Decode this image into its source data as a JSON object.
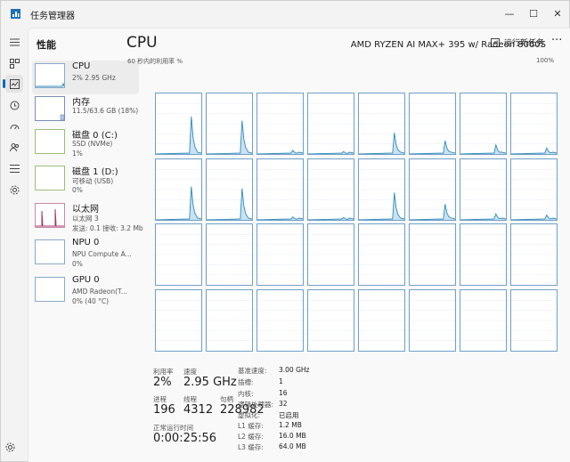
{
  "app": {
    "title": "任务管理器"
  },
  "window_buttons": {
    "minimize": "—",
    "maximize": "☐",
    "close": "✕"
  },
  "page": {
    "title": "性能",
    "run_task": "运行新任务",
    "more": "···"
  },
  "rail": [
    "hamburger-icon",
    "processes-icon",
    "performance-icon",
    "history-icon",
    "startup-icon",
    "users-icon",
    "details-icon",
    "services-icon"
  ],
  "sidebar": [
    {
      "name": "CPU",
      "l2": "2% 2.95 GHz",
      "l3": ""
    },
    {
      "name": "内存",
      "l2": "11.5/63.6 GB (18%)",
      "l3": ""
    },
    {
      "name": "磁盘 0 (C:)",
      "l2": "SSD (NVMe)",
      "l3": "1%"
    },
    {
      "name": "磁盘 1 (D:)",
      "l2": "可移动 (USB)",
      "l3": "0%"
    },
    {
      "name": "以太网",
      "l2": "以太网 3",
      "l3": "发送: 0.1  接收: 3.2 Mb"
    },
    {
      "name": "NPU 0",
      "l2": "NPU Compute A...",
      "l3": "0%"
    },
    {
      "name": "GPU 0",
      "l2": "AMD Radeon(T...",
      "l3": "0% (40 °C)"
    }
  ],
  "main": {
    "title": "CPU",
    "model": "AMD RYZEN AI MAX+ 395 w/ Radeon 8060S",
    "util_label": "60 秒内的利用率 %",
    "util_max": "100%"
  },
  "stats": {
    "utilization_label": "利用率",
    "utilization": "2%",
    "speed_label": "速度",
    "speed": "2.95 GHz",
    "processes_label": "进程",
    "processes": "196",
    "threads_label": "线程",
    "threads": "4312",
    "handles_label": "句柄",
    "handles": "228982",
    "uptime_label": "正常运行时间",
    "uptime": "0:00:25:56"
  },
  "specs": [
    {
      "k": "基准速度:",
      "v": "3.00 GHz"
    },
    {
      "k": "插槽:",
      "v": "1"
    },
    {
      "k": "内核:",
      "v": "16"
    },
    {
      "k": "逻辑处理器:",
      "v": "32"
    },
    {
      "k": "虚拟化:",
      "v": "已启用"
    },
    {
      "k": "L1 缓存:",
      "v": "1.2 MB"
    },
    {
      "k": "L2 缓存:",
      "v": "16.0 MB"
    },
    {
      "k": "L3 缓存:",
      "v": "64.0 MB"
    }
  ],
  "colors": {
    "graph_line": "#2f8bbd",
    "graph_fill": "#c9e2f1",
    "grid_border": "#6f9fcc",
    "accent": "#0067c0",
    "ethernet": "#a3336b"
  },
  "core_peaks": [
    0.62,
    0.55,
    0.06,
    0.04,
    0.35,
    0.22,
    0.15,
    0.1,
    0.55,
    0.52,
    0.05,
    0.04,
    0.45,
    0.26,
    0.1,
    0.08
  ]
}
